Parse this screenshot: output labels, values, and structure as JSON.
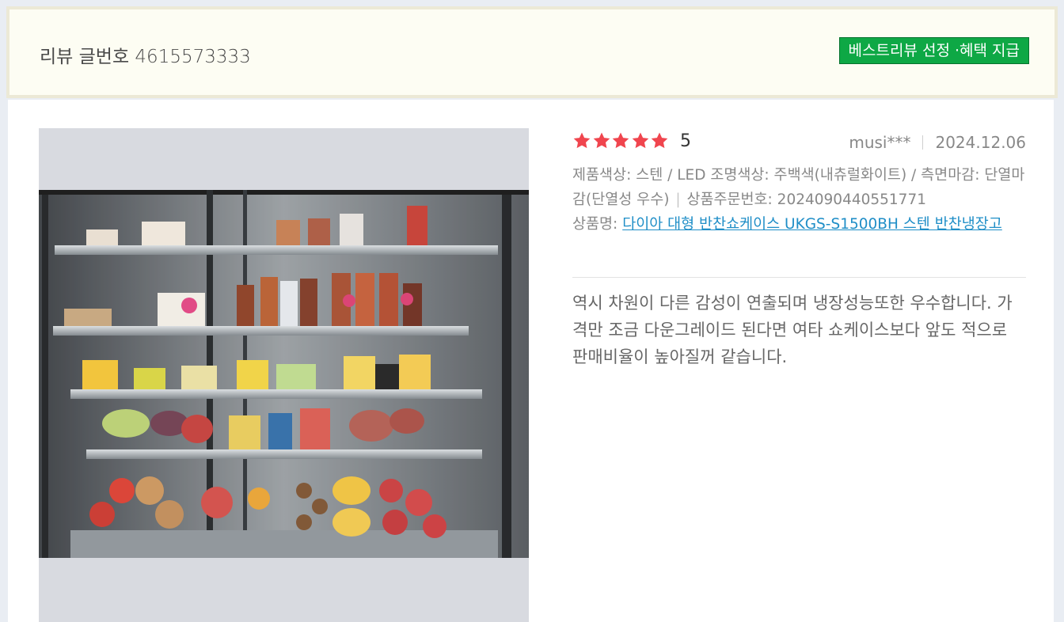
{
  "header": {
    "review_number": "리뷰 글번호 4615573333",
    "best_badge": "베스트리뷰 선정 ·혜택 지급"
  },
  "review": {
    "rating": "5",
    "stars": 5,
    "user": "musi***",
    "date": "2024.12.06",
    "options_label": "제품색상: 스텐 / LED 조명색상: 주백색(내츄럴화이트) / 측면마감: 단열마감(단열성 우수)",
    "order_label": "상품주문번호: 2024090440551771",
    "product_label": "상품명: ",
    "product_name": "다이아 대형 반찬쇼케이스 UKGS-S1500BH 스텐 반찬냉장고",
    "content": "역시 차원이 다른 감성이 연출되며 냉장성능또한 우수합니다. 가격만 조금 다운그레이드 된다면 여타 쇼케이스보다 앞도 적으로 판매비율이 높아질꺼 같습니다.",
    "photo_alt": "refrigerated showcase with fruits and side dishes"
  },
  "colors": {
    "star": "#f0454e",
    "badge_bg": "#0ea845",
    "link": "#1f8ec7",
    "header_bg": "#fdfdf3"
  }
}
